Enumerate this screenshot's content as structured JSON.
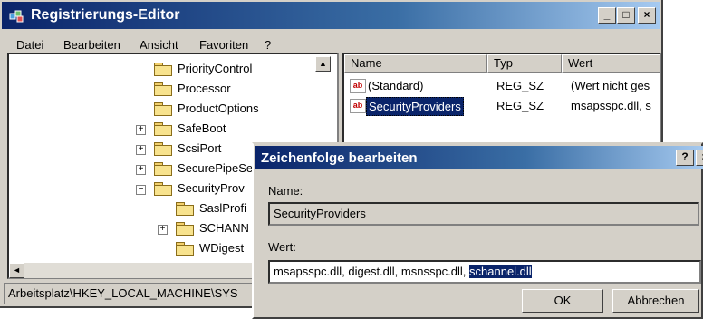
{
  "window": {
    "title": "Registrierungs-Editor",
    "min_label": "_",
    "max_label": "□",
    "close_label": "×"
  },
  "menu": [
    "Datei",
    "Bearbeiten",
    "Ansicht",
    "Favoriten",
    "?"
  ],
  "tree": {
    "nodes": [
      {
        "label": "PriorityControl"
      },
      {
        "label": "Processor"
      },
      {
        "label": "ProductOptions"
      },
      {
        "label": "SafeBoot",
        "expander": "+"
      },
      {
        "label": "ScsiPort",
        "expander": "+"
      },
      {
        "label": "SecurePipeSe",
        "expander": "+"
      },
      {
        "label": "SecurityProv",
        "expander": "−"
      },
      {
        "label": "SaslProfi"
      },
      {
        "label": "SCHANN",
        "expander": "+"
      },
      {
        "label": "WDigest"
      }
    ],
    "scroll_left": "◄",
    "scroll_up": "▲"
  },
  "list": {
    "columns": [
      "Name",
      "Typ",
      "Wert"
    ],
    "rows": [
      {
        "icon": "ab",
        "name": "(Standard)",
        "type": "REG_SZ",
        "value": "(Wert nicht ges"
      },
      {
        "icon": "ab",
        "name": "SecurityProviders",
        "type": "REG_SZ",
        "value": "msapsspc.dll, s"
      }
    ]
  },
  "status": "Arbeitsplatz\\HKEY_LOCAL_MACHINE\\SYS",
  "dialog": {
    "title": "Zeichenfolge bearbeiten",
    "help_label": "?",
    "close_label": "×",
    "name_label": "Name:",
    "name_value": "SecurityProviders",
    "value_label": "Wert:",
    "value_text": "msapsspc.dll, digest.dll, msnsspc.dll, ",
    "value_selected": "schannel.dll",
    "ok_label": "OK",
    "cancel_label": "Abbrechen"
  }
}
